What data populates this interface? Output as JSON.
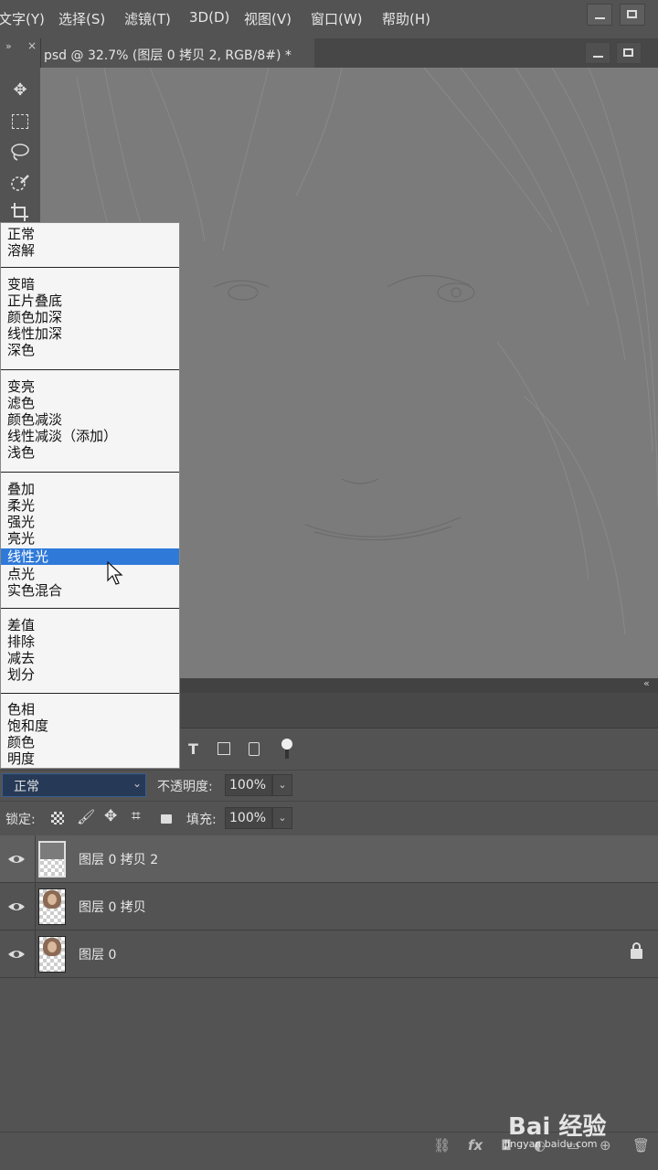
{
  "menubar": {
    "items": [
      "文字(Y)",
      "选择(S)",
      "滤镜(T)",
      "3D(D)",
      "视图(V)",
      "窗口(W)",
      "帮助(H)"
    ]
  },
  "document": {
    "tab_label": "psd @ 32.7% (图层 0 拷贝 2, RGB/8#) *"
  },
  "blend_modes": {
    "highlighted": "线性光",
    "groups": [
      [
        "正常",
        "溶解"
      ],
      [
        "变暗",
        "正片叠底",
        "颜色加深",
        "线性加深",
        "深色"
      ],
      [
        "变亮",
        "滤色",
        "颜色减淡",
        "线性减淡（添加）",
        "浅色"
      ],
      [
        "叠加",
        "柔光",
        "强光",
        "亮光",
        "线性光",
        "点光",
        "实色混合"
      ],
      [
        "差值",
        "排除",
        "减去",
        "划分"
      ],
      [
        "色相",
        "饱和度",
        "颜色",
        "明度"
      ]
    ]
  },
  "layers_panel": {
    "blend_mode_value": "正常",
    "opacity_label": "不透明度:",
    "opacity_value": "100%",
    "lock_label": "锁定:",
    "fill_label": "填充:",
    "fill_value": "100%",
    "filter_text_icon": "T",
    "layers": [
      {
        "name": "图层 0 拷贝 2",
        "selected": true,
        "thumb": "gray",
        "locked": false
      },
      {
        "name": "图层 0 拷贝",
        "selected": false,
        "thumb": "photo",
        "locked": false
      },
      {
        "name": "图层 0",
        "selected": false,
        "thumb": "photo",
        "locked": true
      }
    ],
    "bottom_fx_label": "fx"
  },
  "watermark": {
    "text": "Bai 经验",
    "url": "jingyan.baidu.com"
  },
  "colors": {
    "highlight": "#2f7ad9",
    "selected_field": "#263a57"
  }
}
